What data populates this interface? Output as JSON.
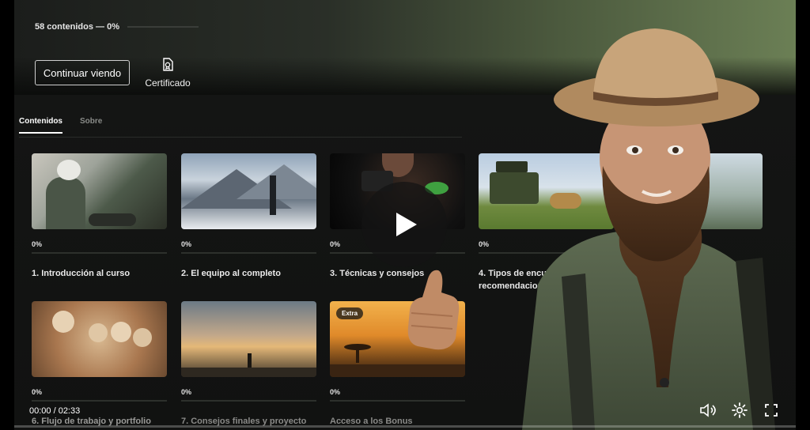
{
  "course": {
    "progress_text": "58 contenidos — 0%",
    "progress_percent": 0,
    "continue_label": "Continuar viendo",
    "certificate_label": "Certificado"
  },
  "tabs": [
    {
      "label": "Contenidos",
      "active": true
    },
    {
      "label": "Sobre",
      "active": false
    }
  ],
  "lessons": [
    {
      "progress": "0%",
      "title": "1. Introducción al curso"
    },
    {
      "progress": "0%",
      "title": "2. El equipo al completo"
    },
    {
      "progress": "0%",
      "title": "3. Técnicas y consejos"
    },
    {
      "progress": "0%",
      "title": "4. Tipos de encuentro y recomendaciones"
    },
    {
      "progress": "0%",
      "title": "6. Flujo de trabajo y portfolio"
    },
    {
      "progress": "0%",
      "title": "7. Consejos finales y proyecto final"
    },
    {
      "progress": "0%",
      "title": "Acceso a los Bonus",
      "badge": "Extra"
    }
  ],
  "player": {
    "time": "00:00 / 02:33",
    "played_fraction": 0,
    "icons": [
      "play-icon",
      "volume-icon",
      "settings-icon",
      "fullscreen-icon"
    ]
  },
  "colors": {
    "accent": "#ffffff",
    "panel": "#121312"
  }
}
